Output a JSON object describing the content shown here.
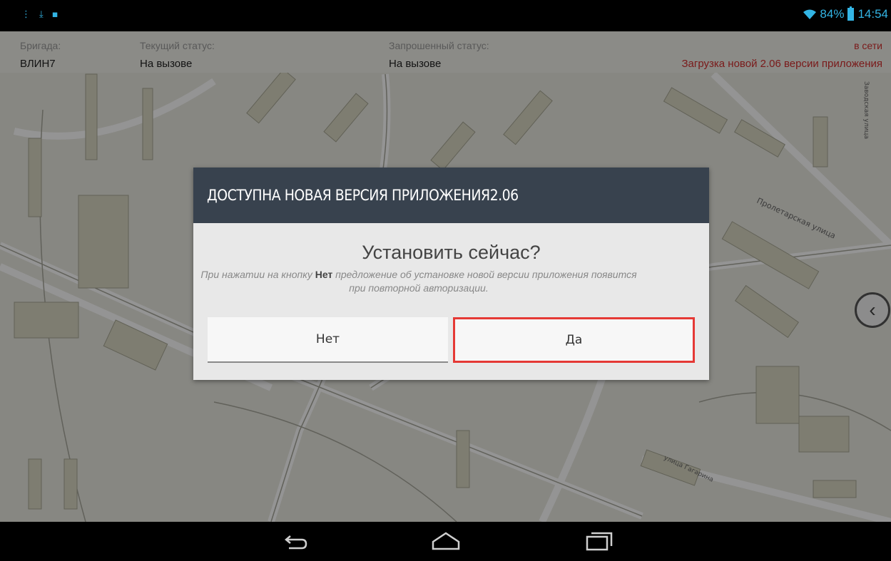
{
  "status_bar": {
    "left_icons": [
      "notification-icon",
      "download-icon",
      "sd-card-icon"
    ],
    "battery": "84%",
    "time": "14:54",
    "accent_color": "#33b5e5"
  },
  "header": {
    "brigade_label": "Бригада:",
    "brigade_value": "ВЛИН7",
    "current_status_label": "Текущий статус:",
    "current_status_value": "На вызове",
    "requested_status_label": "Запрошенный статус:",
    "requested_status_value": "На вызове",
    "network_status": "в сети",
    "update_message": "Загрузка новой 2.06 версии приложения",
    "alert_color": "#d32f2f"
  },
  "dialog": {
    "title": "ДОСТУПНА НОВАЯ ВЕРСИЯ ПРИЛОЖЕНИЯ2.06",
    "question": "Установить сейчас?",
    "note_before": "При нажатии на кнопку ",
    "note_bold": "Нет",
    "note_after": " предложение об установке новой версии приложения появится при повторной авторизации.",
    "no_label": "Нет",
    "yes_label": "Да",
    "header_color": "#38424e",
    "highlight_color": "#e53935"
  },
  "map": {
    "street_label_1": "Пролетарская улица",
    "street_label_2": "Заводская улица",
    "street_label_3": "улица Гагарина"
  },
  "side_button": {
    "icon": "chevron-left-icon"
  },
  "nav_bar": {
    "icons": [
      "back-icon",
      "home-icon",
      "recent-apps-icon"
    ]
  }
}
